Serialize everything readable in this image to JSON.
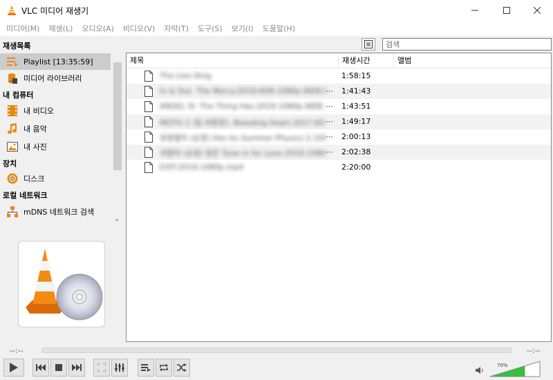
{
  "window": {
    "title": "VLC 미디어 재생기"
  },
  "menu": [
    "미디어(M)",
    "재생(L)",
    "오디오(A)",
    "비디오(V)",
    "자막(T)",
    "도구(S)",
    "보기(I)",
    "도움말(H)"
  ],
  "search": {
    "placeholder": "검색"
  },
  "sidebar": {
    "sections": {
      "playlist": "재생목록",
      "my_computer": "내 컴퓨터",
      "devices": "장치",
      "local_network": "로컬 네트워크"
    },
    "items": {
      "playlist": "Playlist [13:35:59]",
      "media_library": "미디어 라이브러리",
      "my_videos": "내 비디오",
      "my_music": "내 음악",
      "my_pictures": "내 사진",
      "disc": "디스크",
      "mdns": "mDNS 네트워크 검색"
    }
  },
  "playlist": {
    "columns": {
      "title": "제목",
      "duration": "재생시간",
      "album": "앨범"
    },
    "rows": [
      {
        "title": "The Lion King",
        "ellipsis": "",
        "duration": "1:58:15"
      },
      {
        "title": "In & Out. The Mercy.2018.KOR.1080p.WEB-DL.H264",
        "ellipsis": "⋯",
        "duration": "1:41:43"
      },
      {
        "title": "ANGEL III. The Thing Has.2018.1080p.WEB-DL.H264",
        "ellipsis": "⋯",
        "duration": "1:43:51"
      },
      {
        "title": "MOTH 2 (팀 버튼판), Bleeding Heart.2017.KOR.1080p",
        "ellipsis": "⋯",
        "duration": "1:49:17"
      },
      {
        "title": "유령열차 (순정) Hes Its Summer Physics 2.1080p.WEB",
        "ellipsis": "⋯",
        "duration": "2:00:13"
      },
      {
        "title": "귀향의 (순정) 빛은 Tune in for Love.2019.1080p.WEB",
        "ellipsis": "⋯",
        "duration": "2:02:38"
      },
      {
        "title": "EXIT.2019.1080p.mp4",
        "ellipsis": "",
        "duration": "2:20:00"
      }
    ]
  },
  "controls": {
    "time_elapsed": "--:--",
    "time_remaining": "--:--",
    "volume_label": "70%",
    "volume_level": 0.7
  }
}
